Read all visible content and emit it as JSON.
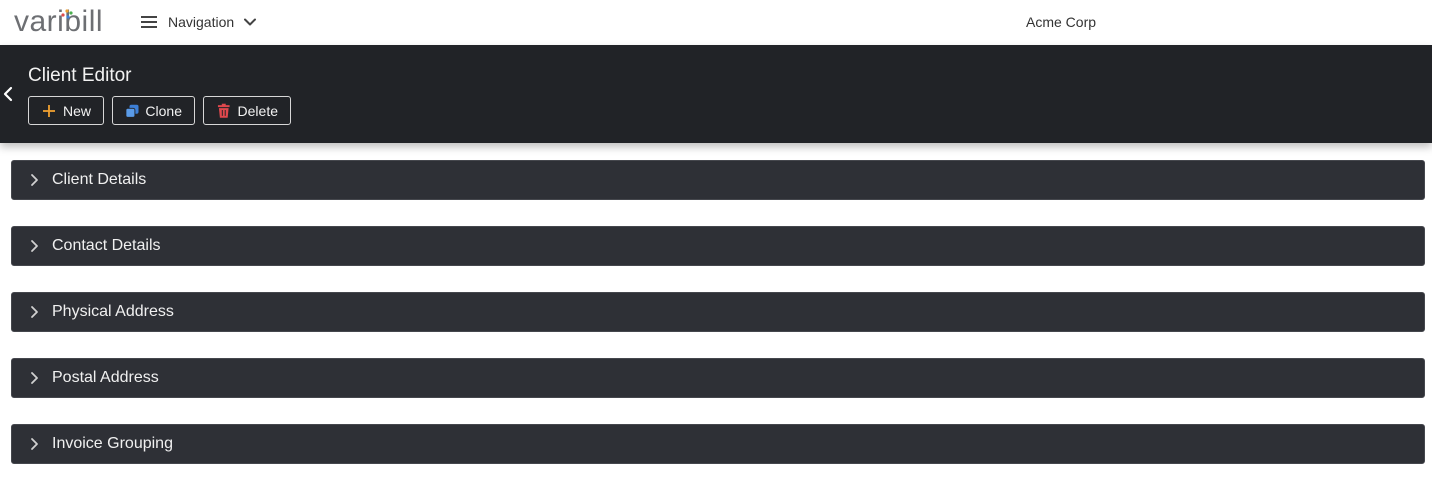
{
  "brand": {
    "logo_text_left": "vari",
    "logo_text_right": "ill",
    "logo_letter": "b"
  },
  "topbar": {
    "nav_label": "Navigation",
    "company": "Acme Corp"
  },
  "header": {
    "title": "Client Editor",
    "buttons": {
      "new": "New",
      "clone": "Clone",
      "delete": "Delete"
    }
  },
  "sections": [
    {
      "label": "Client Details"
    },
    {
      "label": "Contact Details"
    },
    {
      "label": "Physical Address"
    },
    {
      "label": "Postal Address"
    },
    {
      "label": "Invoice Grouping"
    }
  ],
  "colors": {
    "header_bg": "#212327",
    "panel_bg": "#2e3036",
    "new_icon": "#f0a030",
    "clone_icon": "#3d7fd6",
    "delete_icon": "#e0484d"
  },
  "icons": [
    "menu-icon",
    "chevron-down-icon",
    "chevron-left-icon",
    "plus-icon",
    "copy-icon",
    "trash-icon",
    "chevron-right-icon"
  ]
}
